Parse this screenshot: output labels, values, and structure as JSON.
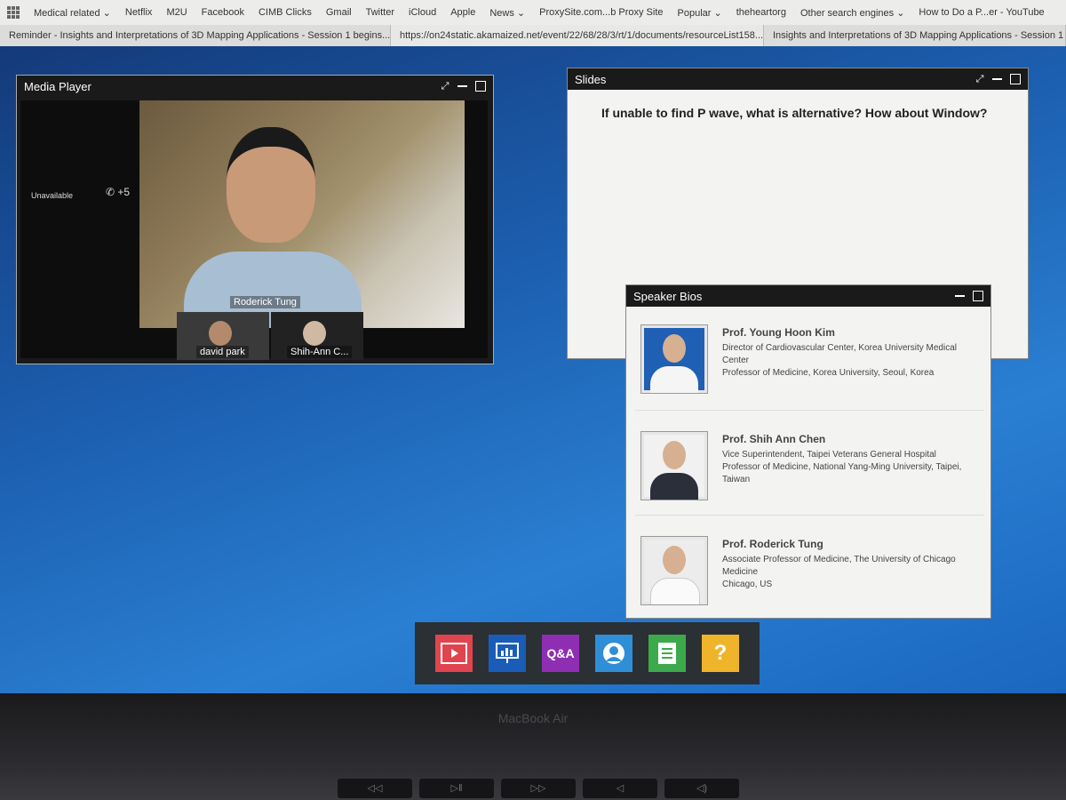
{
  "browser": {
    "bookmarks": [
      "Medical related ⌄",
      "Netflix",
      "M2U",
      "Facebook",
      "CIMB Clicks",
      "Gmail",
      "Twitter",
      "iCloud",
      "Apple",
      "News ⌄",
      "ProxySite.com...b Proxy Site",
      "Popular ⌄",
      "theheartorg",
      "Other search engines ⌄",
      "How to Do a P...er - YouTube"
    ],
    "tabs": [
      "Reminder - Insights and Interpretations of 3D Mapping Applications - Session 1 begins...",
      "https://on24static.akamaized.net/event/22/68/28/3/rt/1/documents/resourceList158...",
      "Insights and Interpretations of 3D Mapping Applications - Session 1"
    ]
  },
  "media_player": {
    "title": "Media Player",
    "status": "Unavailable",
    "call_count": "+5",
    "main_speaker": "Roderick Tung",
    "thumbnails": [
      "david park",
      "Shih-Ann C..."
    ]
  },
  "slides": {
    "title": "Slides",
    "question": "If unable to find P wave, what is alternative? How about Window?"
  },
  "speaker_bios": {
    "title": "Speaker Bios",
    "speakers": [
      {
        "name": "Prof. Young Hoon Kim",
        "desc": "Director of Cardiovascular Center, Korea University Medical Center\nProfessor of Medicine, Korea University, Seoul, Korea"
      },
      {
        "name": "Prof. Shih Ann Chen",
        "desc": "Vice Superintendent, Taipei Veterans General Hospital\nProfessor of Medicine, National Yang-Ming University, Taipei, Taiwan"
      },
      {
        "name": "Prof. Roderick Tung",
        "desc": "Associate Professor of Medicine, The University of Chicago Medicine\nChicago, US"
      }
    ]
  },
  "dock": {
    "qa_label": "Q&A",
    "help_label": "?"
  },
  "bezel": {
    "brand": "MacBook Air"
  }
}
